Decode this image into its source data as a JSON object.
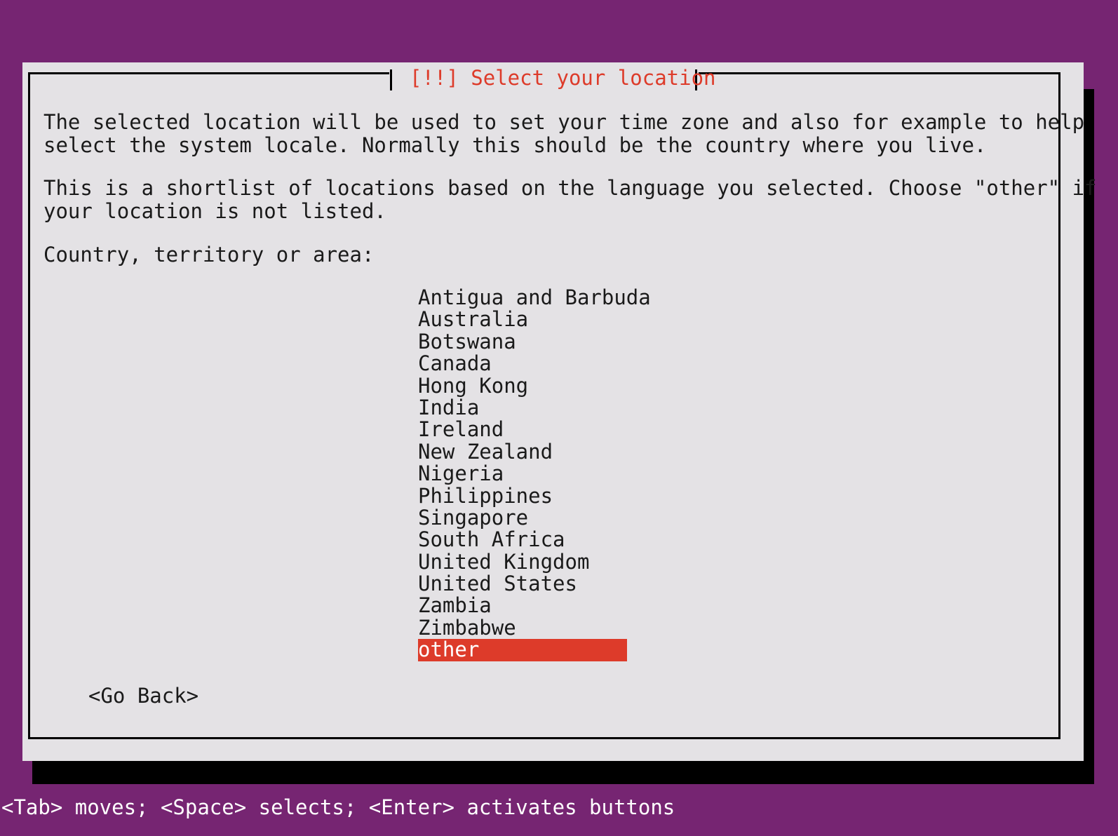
{
  "screen": {
    "background_color": "#762572",
    "panel_color": "#e4e2e5",
    "accent_color": "#dd3b2a",
    "text_color": "#1a1a1a",
    "shadow_color": "#000000"
  },
  "dialog": {
    "title": "[!!] Select your location",
    "intro_paragraph": "The selected location will be used to set your time zone and also for example to help\nselect the system locale. Normally this should be the country where you live.",
    "shortlist_paragraph": "This is a shortlist of locations based on the language you selected. Choose \"other\" if\nyour location is not listed.",
    "field_label": "Country, territory or area:"
  },
  "country_list": {
    "selected": "other",
    "items": [
      {
        "label": "Antigua and Barbuda",
        "selected": false
      },
      {
        "label": "Australia",
        "selected": false
      },
      {
        "label": "Botswana",
        "selected": false
      },
      {
        "label": "Canada",
        "selected": false
      },
      {
        "label": "Hong Kong",
        "selected": false
      },
      {
        "label": "India",
        "selected": false
      },
      {
        "label": "Ireland",
        "selected": false
      },
      {
        "label": "New Zealand",
        "selected": false
      },
      {
        "label": "Nigeria",
        "selected": false
      },
      {
        "label": "Philippines",
        "selected": false
      },
      {
        "label": "Singapore",
        "selected": false
      },
      {
        "label": "South Africa",
        "selected": false
      },
      {
        "label": "United Kingdom",
        "selected": false
      },
      {
        "label": "United States",
        "selected": false
      },
      {
        "label": "Zambia",
        "selected": false
      },
      {
        "label": "Zimbabwe",
        "selected": false
      },
      {
        "label": "other",
        "selected": true
      }
    ]
  },
  "buttons": {
    "go_back": "<Go Back>"
  },
  "status_bar": {
    "hint": "<Tab> moves; <Space> selects; <Enter> activates buttons"
  }
}
